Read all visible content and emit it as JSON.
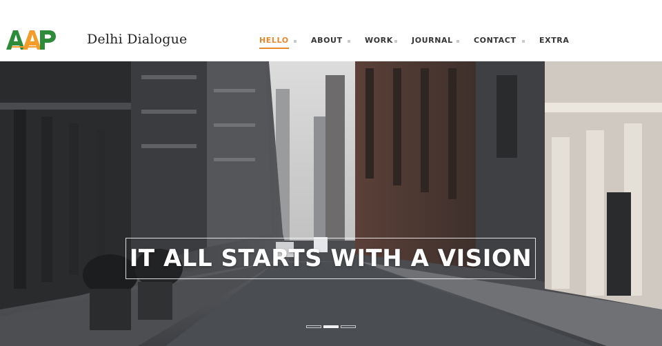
{
  "header": {
    "logo_text": "AAP",
    "site_title": "Delhi Dialogue"
  },
  "nav": {
    "items": [
      {
        "label": "HELLO",
        "active": true
      },
      {
        "label": "ABOUT",
        "active": false
      },
      {
        "label": "WORK",
        "active": false
      },
      {
        "label": "JOURNAL",
        "active": false
      },
      {
        "label": "CONTACT",
        "active": false
      },
      {
        "label": "EXTRA",
        "active": false
      }
    ]
  },
  "hero": {
    "tagline": "IT ALL STARTS WITH A VISION",
    "slides": [
      {
        "active": false
      },
      {
        "active": true
      },
      {
        "active": false
      }
    ]
  },
  "colors": {
    "accent": "#e8862a",
    "logo_green": "#2e8b3a",
    "logo_saffron": "#f39c2a"
  }
}
